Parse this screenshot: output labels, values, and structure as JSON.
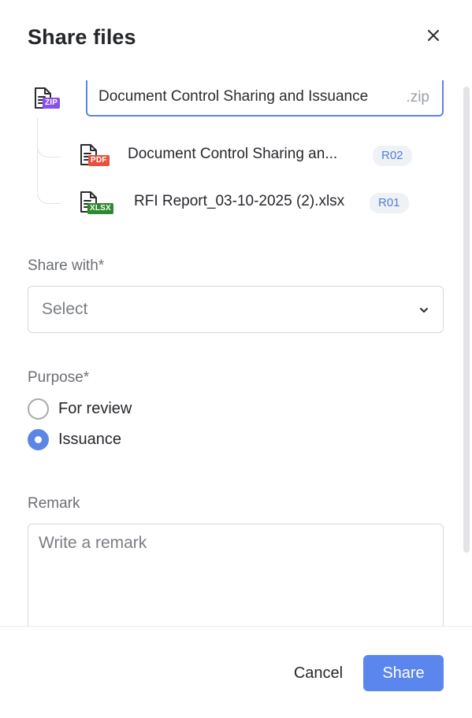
{
  "dialog": {
    "title": "Share files",
    "close_icon": "close-icon"
  },
  "files": {
    "zip": {
      "badge": "ZIP",
      "badge_color": "#8a4fe6",
      "name_value": "Document Control Sharing and Issuance",
      "extension": ".zip"
    },
    "children": [
      {
        "badge": "PDF",
        "badge_color": "#e5533f",
        "name": "Document Control Sharing an...",
        "revision": "R02"
      },
      {
        "badge": "XLSX",
        "badge_color": "#2e8a2f",
        "name": "RFI Report_03-10-2025 (2).xlsx",
        "revision": "R01"
      }
    ]
  },
  "share_with": {
    "label": "Share with*",
    "selected": "Select",
    "chevron_icon": "chevron-down-icon"
  },
  "purpose": {
    "label": "Purpose*",
    "options": [
      {
        "label": "For review",
        "checked": false
      },
      {
        "label": "Issuance",
        "checked": true
      }
    ]
  },
  "remark": {
    "label": "Remark",
    "placeholder": "Write a remark"
  },
  "footer": {
    "cancel_label": "Cancel",
    "share_label": "Share"
  },
  "colors": {
    "accent": "#5b86ee",
    "revision_text": "#4f7fd6"
  }
}
